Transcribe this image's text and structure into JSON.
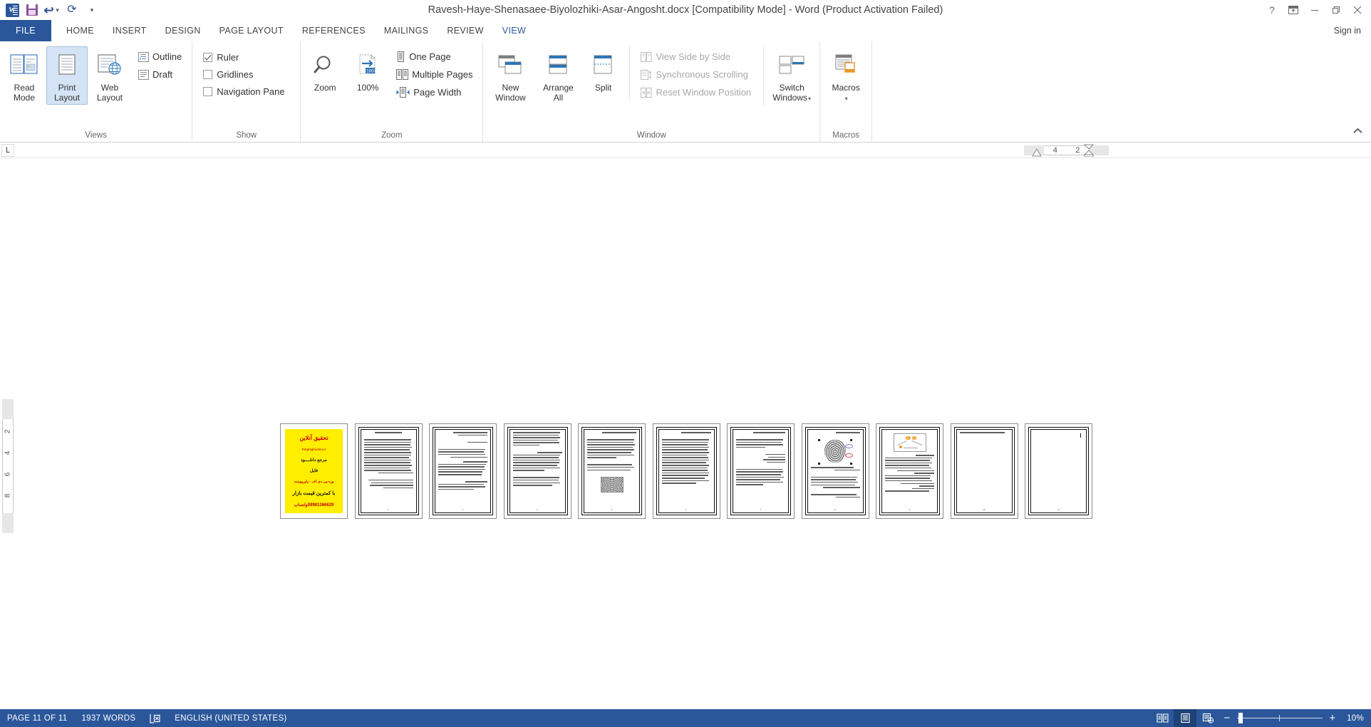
{
  "app": {
    "title": "Ravesh-Haye-Shenasaee-Biyolozhiki-Asar-Angosht.docx [Compatibility Mode] - Word (Product Activation Failed)",
    "signin": "Sign in"
  },
  "quick_access": {
    "word_logo": "W",
    "save": "save-icon",
    "undo": "undo-icon",
    "redo": "redo-icon",
    "customize": "customize-qat-icon"
  },
  "window_controls": {
    "help": "help-icon",
    "ribbon_options": "ribbon-display-options-icon",
    "minimize": "minimize-icon",
    "restore": "restore-icon",
    "close": "close-icon"
  },
  "tabs": [
    {
      "label": "FILE",
      "active": false,
      "file": true
    },
    {
      "label": "HOME",
      "active": false
    },
    {
      "label": "INSERT",
      "active": false
    },
    {
      "label": "DESIGN",
      "active": false
    },
    {
      "label": "PAGE LAYOUT",
      "active": false
    },
    {
      "label": "REFERENCES",
      "active": false
    },
    {
      "label": "MAILINGS",
      "active": false
    },
    {
      "label": "REVIEW",
      "active": false
    },
    {
      "label": "VIEW",
      "active": true
    }
  ],
  "ribbon": {
    "collapse_label": "^",
    "groups": {
      "views": {
        "label": "Views",
        "read_mode": "Read\nMode",
        "read_mode_l1": "Read",
        "read_mode_l2": "Mode",
        "print_layout_l1": "Print",
        "print_layout_l2": "Layout",
        "web_layout_l1": "Web",
        "web_layout_l2": "Layout",
        "outline": "Outline",
        "draft": "Draft"
      },
      "show": {
        "label": "Show",
        "ruler": "Ruler",
        "ruler_checked": true,
        "gridlines": "Gridlines",
        "gridlines_checked": false,
        "navigation_pane": "Navigation Pane",
        "navigation_pane_checked": false
      },
      "zoom": {
        "label": "Zoom",
        "zoom_btn": "Zoom",
        "hundred_pct": "100%",
        "hundred_badge": "100",
        "one_page": "One Page",
        "multiple_pages": "Multiple Pages",
        "page_width": "Page Width"
      },
      "window": {
        "label": "Window",
        "new_window_l1": "New",
        "new_window_l2": "Window",
        "arrange_all_l1": "Arrange",
        "arrange_all_l2": "All",
        "split": "Split",
        "view_side_by_side": "View Side by Side",
        "synchronous_scrolling": "Synchronous Scrolling",
        "reset_window_position": "Reset Window Position",
        "switch_windows_l1": "Switch",
        "switch_windows_l2": "Windows"
      },
      "macros": {
        "label": "Macros",
        "macros_btn": "Macros"
      }
    }
  },
  "ruler": {
    "corner_label": "L",
    "horizontal_marks": [
      "4",
      "2"
    ],
    "vertical_marks": [
      "2",
      "4",
      "6",
      "8"
    ]
  },
  "document": {
    "page_count": 11,
    "pages": [
      {
        "n": 1,
        "type": "cover",
        "cover": {
          "title": "تحقیق آنلاین",
          "site": "Tahghighonline.ir",
          "l1": "مرجع دانلــــود",
          "l2": "فایل",
          "l3": "ورد-پی دی اف - پاورپوینت",
          "l4": "با کمترین قیمت بازار",
          "l5": "09981366629واتساپ"
        }
      },
      {
        "n": 2,
        "type": "text"
      },
      {
        "n": 3,
        "type": "text"
      },
      {
        "n": 4,
        "type": "text"
      },
      {
        "n": 5,
        "type": "text-image"
      },
      {
        "n": 6,
        "type": "text"
      },
      {
        "n": 7,
        "type": "text"
      },
      {
        "n": 8,
        "type": "fingerprint"
      },
      {
        "n": 9,
        "type": "diagram"
      },
      {
        "n": 10,
        "type": "sparse"
      },
      {
        "n": 11,
        "type": "empty"
      }
    ]
  },
  "status_bar": {
    "page_info": "PAGE 11 OF 11",
    "word_count": "1937 WORDS",
    "proofing_icon": "proofing-errors-icon",
    "language": "ENGLISH (UNITED STATES)",
    "view_read_mode": "read-mode-icon",
    "view_print_layout": "print-layout-icon",
    "view_web_layout": "web-layout-icon",
    "zoom_out": "−",
    "zoom_in": "+",
    "zoom_level": "10%"
  }
}
